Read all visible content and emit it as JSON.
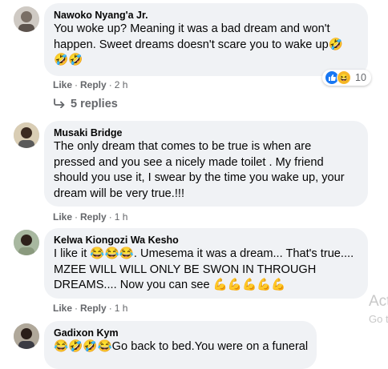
{
  "comments": [
    {
      "author": "Nawoko Nyang'a Jr.",
      "lines": [
        "You woke up? Meaning it was a bad dream and won't",
        "happen. Sweet dreams doesn't scare you to wake up🤣",
        "🤣🤣"
      ],
      "like": "Like",
      "reply": "Reply",
      "sep": "·",
      "time": "2 h",
      "reaction_count": "10",
      "replies_label": "5 replies"
    },
    {
      "author": "Musaki Bridge",
      "lines": [
        "The only dream that comes to be true is when are",
        "pressed and you see a nicely made toilet . My friend",
        "should you use it, I swear by the time you wake up, your",
        "dream will be very true.!!!"
      ],
      "like": "Like",
      "reply": "Reply",
      "sep": "·",
      "time": "1 h"
    },
    {
      "author": "Kelwa Kiongozi Wa Kesho",
      "lines": [
        "I like it 😂😂😂. Umesema it was a dream... That's true....",
        "MZEE WILL WILL ONLY BE SWON IN THROUGH",
        "DREAMS.... Now you can see 💪💪💪💪💪"
      ],
      "like": "Like",
      "reply": "Reply",
      "sep": "·",
      "time": "1 h"
    },
    {
      "author": "Gadixon Kym",
      "lines": [
        "😂🤣🤣😂Go back to bed.You were on a funeral"
      ]
    }
  ],
  "watermark": {
    "line1": "Act",
    "line2": "Go t"
  },
  "colors": {
    "bubble": "#f0f2f5",
    "meta": "#65676b",
    "like_blue": "#1877f2",
    "haha_yellow": "#f7b928"
  }
}
